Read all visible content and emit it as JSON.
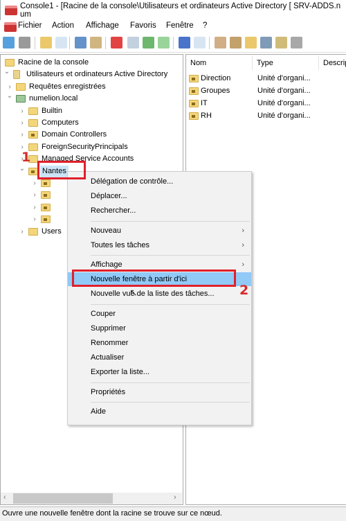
{
  "window": {
    "title": "Console1 - [Racine de la console\\Utilisateurs et ordinateurs Active Directory [ SRV-ADDS.num"
  },
  "menubar": [
    "Fichier",
    "Action",
    "Affichage",
    "Favoris",
    "Fenêtre",
    "?"
  ],
  "toolbar": [
    "back-icon",
    "forward-icon",
    "up-folder-icon",
    "show-hide-tree-icon",
    "cut-icon",
    "paste-icon",
    "delete-icon",
    "properties-icon",
    "refresh-icon",
    "export-icon",
    "help-icon",
    "show-hide-action-icon",
    "new-user-icon",
    "new-group-icon",
    "new-ou-icon",
    "filter-icon",
    "find-icon",
    "add-member-icon"
  ],
  "tree": [
    {
      "label": "Racine de la console",
      "level": 0,
      "chev": "",
      "icon": "folder"
    },
    {
      "label": "Utilisateurs et ordinateurs Active Directory",
      "level": 0,
      "chev": "down",
      "icon": "aduc"
    },
    {
      "label": "Requêtes enregistrées",
      "level": 1,
      "chev": "right",
      "icon": "folder"
    },
    {
      "label": "numelion.local",
      "level": 1,
      "chev": "down",
      "icon": "domain"
    },
    {
      "label": "Builtin",
      "level": 2,
      "chev": "right",
      "icon": "folder"
    },
    {
      "label": "Computers",
      "level": 2,
      "chev": "right",
      "icon": "folder"
    },
    {
      "label": "Domain Controllers",
      "level": 2,
      "chev": "right",
      "icon": "ou"
    },
    {
      "label": "ForeignSecurityPrincipals",
      "level": 2,
      "chev": "right",
      "icon": "folder"
    },
    {
      "label": "Managed Service Accounts",
      "level": 2,
      "chev": "right",
      "icon": "folder"
    },
    {
      "label": "Nantes",
      "level": 2,
      "chev": "down",
      "icon": "ou",
      "selected": true
    },
    {
      "label": "",
      "level": 3,
      "chev": "right",
      "icon": "ou"
    },
    {
      "label": "",
      "level": 3,
      "chev": "right",
      "icon": "ou"
    },
    {
      "label": "",
      "level": 3,
      "chev": "right",
      "icon": "ou"
    },
    {
      "label": "",
      "level": 3,
      "chev": "right",
      "icon": "ou"
    },
    {
      "label": "Users",
      "level": 2,
      "chev": "right",
      "icon": "folder"
    }
  ],
  "list": {
    "columns": [
      "Nom",
      "Type",
      "Descrip"
    ],
    "rows": [
      {
        "name": "Direction",
        "type": "Unité d'organi..."
      },
      {
        "name": "Groupes",
        "type": "Unité d'organi..."
      },
      {
        "name": "IT",
        "type": "Unité d'organi..."
      },
      {
        "name": "RH",
        "type": "Unité d'organi..."
      }
    ]
  },
  "context_menu": [
    {
      "label": "Délégation de contrôle..."
    },
    {
      "label": "Déplacer..."
    },
    {
      "label": "Rechercher..."
    },
    {
      "sep": true
    },
    {
      "label": "Nouveau",
      "submenu": true
    },
    {
      "label": "Toutes les tâches",
      "submenu": true
    },
    {
      "sep": true
    },
    {
      "label": "Affichage",
      "submenu": true
    },
    {
      "label": "Nouvelle fenêtre à partir d'ici",
      "highlighted": true
    },
    {
      "label": "Nouvelle vue de la liste des tâches..."
    },
    {
      "sep": true
    },
    {
      "label": "Couper"
    },
    {
      "label": "Supprimer"
    },
    {
      "label": "Renommer"
    },
    {
      "label": "Actualiser"
    },
    {
      "label": "Exporter la liste..."
    },
    {
      "sep": true
    },
    {
      "label": "Propriétés"
    },
    {
      "sep": true
    },
    {
      "label": "Aide"
    }
  ],
  "annotations": {
    "step1": "1",
    "step2": "2",
    "color": "#e0202a"
  },
  "statusbar": {
    "text": "Ouvre une nouvelle fenêtre dont la racine se trouve sur ce nœud."
  }
}
